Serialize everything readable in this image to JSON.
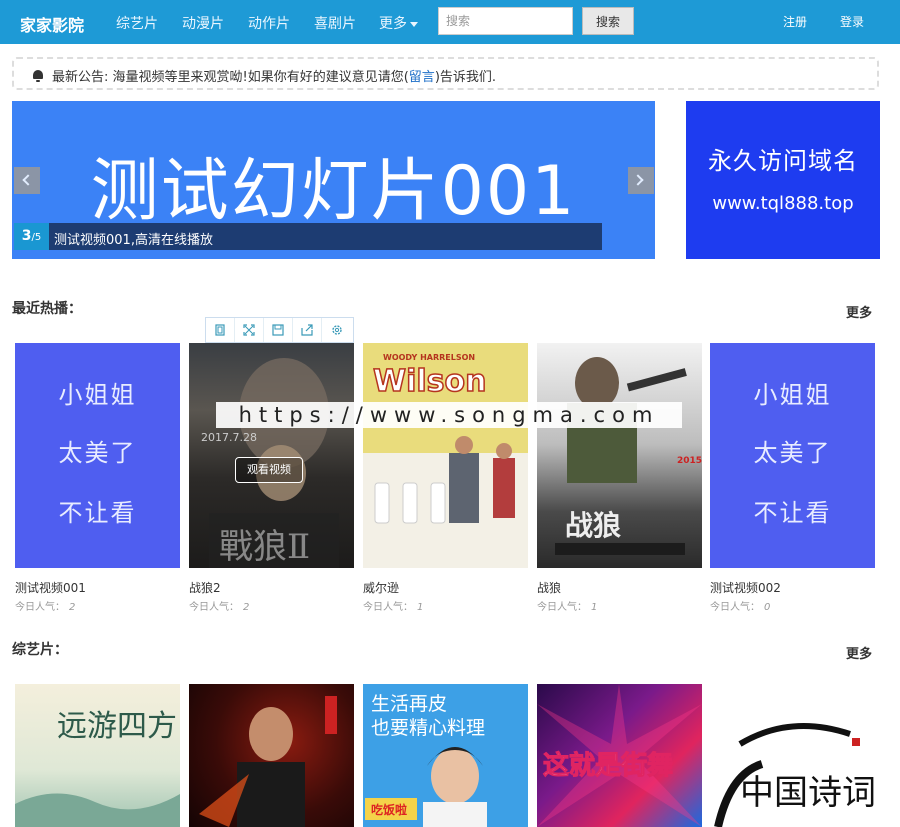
{
  "nav": {
    "brand": "家家影院",
    "items": [
      "综艺片",
      "动漫片",
      "动作片",
      "喜剧片"
    ],
    "more_label": "更多",
    "search_placeholder": "搜索",
    "search_button": "搜索",
    "register": "注册",
    "login": "登录"
  },
  "notice": {
    "prefix": "最新公告: 海量视频等里来观赏呦!如果你有好的建议意见请您(",
    "link": "留言",
    "suffix": ")告诉我们."
  },
  "slider": {
    "slide_text": "测试幻灯片001",
    "current": "3",
    "total": "/5",
    "caption": "测试视频001,高清在线播放"
  },
  "side_ad": {
    "line1": "永久访问域名",
    "line2": "www.tql888.top"
  },
  "watermark": "https://www.songma.com",
  "hot": {
    "title": "最近热播：",
    "more": "更多",
    "items": [
      {
        "title": "测试视频001",
        "pop_label": "今日人气：",
        "pop": "2",
        "poster_lines": [
          "小姐姐",
          "太美了",
          "不让看"
        ]
      },
      {
        "title": "战狼2",
        "pop_label": "今日人气：",
        "pop": "2",
        "play": "观看视频"
      },
      {
        "title": "威尔逊",
        "pop_label": "今日人气：",
        "pop": "1",
        "poster_text": "Wilson",
        "poster_top": "WOODY HARRELSON"
      },
      {
        "title": "战狼",
        "pop_label": "今日人气：",
        "pop": "1",
        "poster_text": "战狼"
      },
      {
        "title": "测试视频002",
        "pop_label": "今日人气：",
        "pop": "0",
        "poster_lines": [
          "小姐姐",
          "太美了",
          "不让看"
        ]
      }
    ]
  },
  "variety": {
    "title": "综艺片：",
    "more": "更多",
    "items": [
      {
        "poster_text": "远游四方"
      },
      {
        "poster_text": ""
      },
      {
        "poster_line1": "生活再皮",
        "poster_line2": "也要精心料理",
        "poster_badge": "吃饭啦"
      },
      {
        "poster_text": "这就是街舞"
      },
      {
        "poster_text": "中国诗词"
      }
    ]
  },
  "colors": {
    "nav": "#1e9ad6",
    "slide_bg": "#3b82f6",
    "ad_bg": "#1e3cf0",
    "placeholder": "#4f5ef0"
  }
}
